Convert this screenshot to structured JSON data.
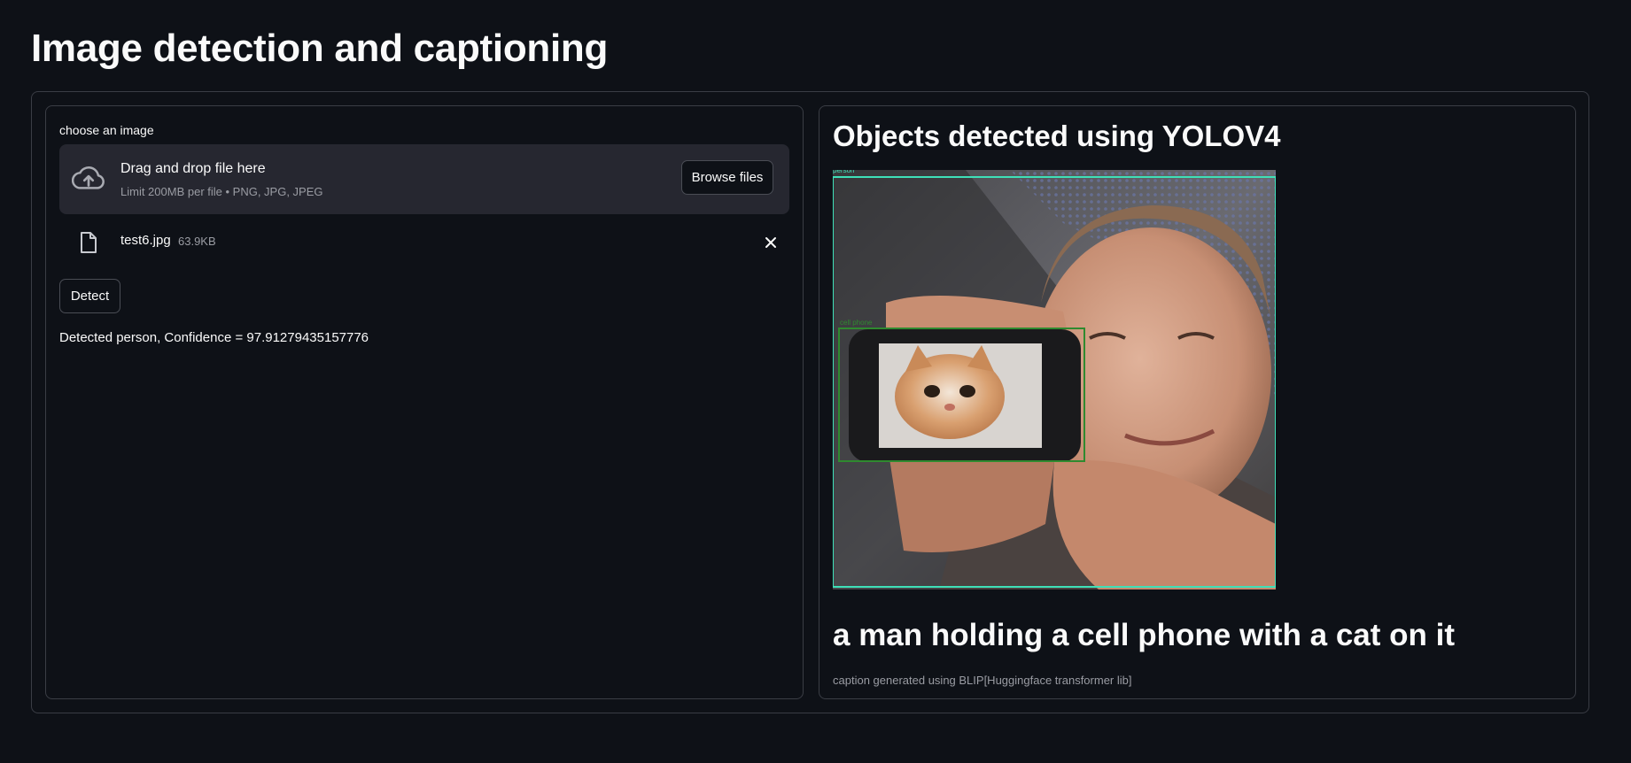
{
  "app": {
    "title": "Image detection and captioning"
  },
  "uploader": {
    "label": "choose an image",
    "drop_title": "Drag and drop file here",
    "drop_hint": "Limit 200MB per file • PNG, JPG, JPEG",
    "browse_label": "Browse files",
    "file": {
      "name": "test6.jpg",
      "size": "63.9KB"
    }
  },
  "actions": {
    "detect_label": "Detect"
  },
  "results": {
    "detection_text": "Detected person, Confidence = 97.91279435157776",
    "heading": "Objects detected using YOLOV4",
    "image_labels": {
      "person": "person",
      "cell_phone": "cell phone"
    },
    "caption": "a man holding a cell phone with a cat on it",
    "caption_source": "caption generated using BLIP[Huggingface transformer lib]"
  },
  "colors": {
    "background": "#0e1117",
    "panel_border": "#3a3d45",
    "dropzone": "#262730",
    "person_box": "#3ee0b8",
    "phone_box": "#2f8a2f"
  },
  "icons": {
    "upload": "cloud-upload-icon",
    "file": "file-icon",
    "remove": "close-icon"
  }
}
